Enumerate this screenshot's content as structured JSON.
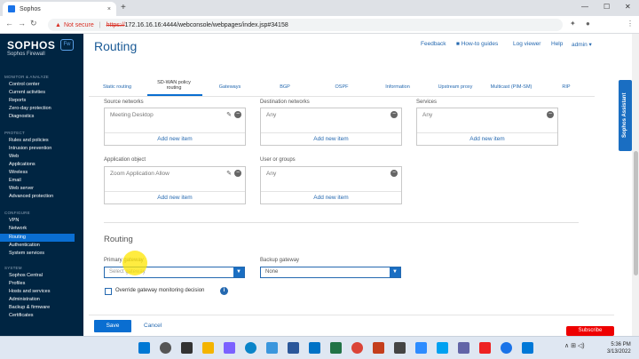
{
  "browser": {
    "tab_title": "Sophos",
    "tab_close": "×",
    "new_tab": "+",
    "warning": "▲",
    "not_secure": "Not secure",
    "separator": "|",
    "url_https": "https://",
    "url_rest": "172.16.16.16:4444/webconsole/webpages/index.jsp#34158"
  },
  "sidebar": {
    "logo": "SOPHOS",
    "subtitle": "Sophos Firewall",
    "badge": "Fw",
    "section_monitor": "MONITOR & ANALYZE",
    "monitor_items": [
      "Control center",
      "Current activities",
      "Reports",
      "Zero-day protection",
      "Diagnostics"
    ],
    "section_protect": "PROTECT",
    "protect_items": [
      "Rules and policies",
      "Intrusion prevention",
      "Web",
      "Applications",
      "Wireless",
      "Email",
      "Web server",
      "Advanced protection"
    ],
    "section_configure": "CONFIGURE",
    "configure_items": [
      "VPN",
      "Network",
      "Routing",
      "Authentication",
      "System services"
    ],
    "section_system": "SYSTEM",
    "system_items": [
      "Sophos Central",
      "Profiles",
      "Hosts and services",
      "Administration",
      "Backup & firmware",
      "Certificates"
    ]
  },
  "header": {
    "title": "Routing",
    "feedback": "Feedback",
    "guides": "How-to guides",
    "log_viewer": "Log viewer",
    "help": "Help",
    "admin": "admin ▾"
  },
  "tabs": [
    "Static routing",
    "SD-WAN policy routing",
    "Gateways",
    "BGP",
    "OSPF",
    "Information",
    "Upstream proxy",
    "Multicast (PIM-SM)",
    "RIP"
  ],
  "form": {
    "source_networks_label": "Source networks",
    "source_networks_value": "Meeting Desktop",
    "destination_networks_label": "Destination networks",
    "destination_networks_value": "Any",
    "services_label": "Services",
    "services_value": "Any",
    "application_object_label": "Application object",
    "application_object_value": "Zoom Application Allow",
    "user_groups_label": "User or groups",
    "user_groups_value": "Any",
    "add_new_item": "Add new item",
    "routing_heading": "Routing",
    "primary_gateway_label": "Primary gateway",
    "primary_gateway_placeholder": "Select gateway",
    "backup_gateway_label": "Backup gateway",
    "backup_gateway_value": "None",
    "override_label": "Override gateway monitoring decision"
  },
  "footer": {
    "save": "Save",
    "cancel": "Cancel"
  },
  "assistant": "Sophos Assistant",
  "subscribe": "Subscribe",
  "taskbar": {
    "tray": "∧  ⊞  ◁)",
    "time": "5:36 PM",
    "date": "3/13/2022"
  }
}
